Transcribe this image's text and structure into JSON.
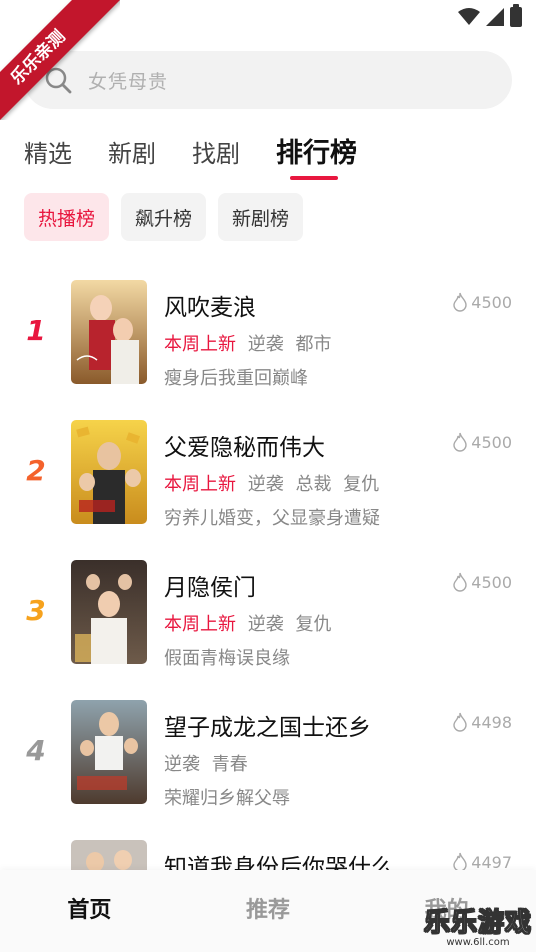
{
  "watermark": {
    "ribbon_text": "乐乐亲测",
    "corner_text": "乐乐游戏",
    "corner_url": "www.6ll.com"
  },
  "search": {
    "placeholder": "女凭母贵"
  },
  "tabs": [
    {
      "label": "精选",
      "active": false
    },
    {
      "label": "新剧",
      "active": false
    },
    {
      "label": "找剧",
      "active": false
    },
    {
      "label": "排行榜",
      "active": true
    }
  ],
  "chips": [
    {
      "label": "热播榜",
      "active": true
    },
    {
      "label": "飙升榜",
      "active": false
    },
    {
      "label": "新剧榜",
      "active": false
    }
  ],
  "ranking": [
    {
      "rank": "1",
      "title": "风吹麦浪",
      "new_tag": "本周上新",
      "tags": [
        "逆袭",
        "都市"
      ],
      "desc": "瘦身后我重回巅峰",
      "heat": "4500",
      "rank_color": "#e8173f"
    },
    {
      "rank": "2",
      "title": "父爱隐秘而伟大",
      "new_tag": "本周上新",
      "tags": [
        "逆袭",
        "总裁",
        "复仇"
      ],
      "desc": "穷养儿婚变，父显豪身遭疑",
      "heat": "4500",
      "rank_color": "#f4622c"
    },
    {
      "rank": "3",
      "title": "月隐侯门",
      "new_tag": "本周上新",
      "tags": [
        "逆袭",
        "复仇"
      ],
      "desc": "假面青梅误良缘",
      "heat": "4500",
      "rank_color": "#f6a21d"
    },
    {
      "rank": "4",
      "title": "望子成龙之国士还乡",
      "new_tag": "",
      "tags": [
        "逆袭",
        "青春"
      ],
      "desc": "荣耀归乡解父辱",
      "heat": "4498",
      "rank_color": "#999999"
    },
    {
      "rank": "",
      "title": "知道我身份后你哭什么",
      "new_tag": "",
      "tags": [],
      "desc": "",
      "heat": "4497",
      "rank_color": "#999999"
    }
  ],
  "bottom_nav": [
    {
      "label": "首页",
      "active": true
    },
    {
      "label": "推荐",
      "active": false
    },
    {
      "label": "我的",
      "active": false
    }
  ]
}
